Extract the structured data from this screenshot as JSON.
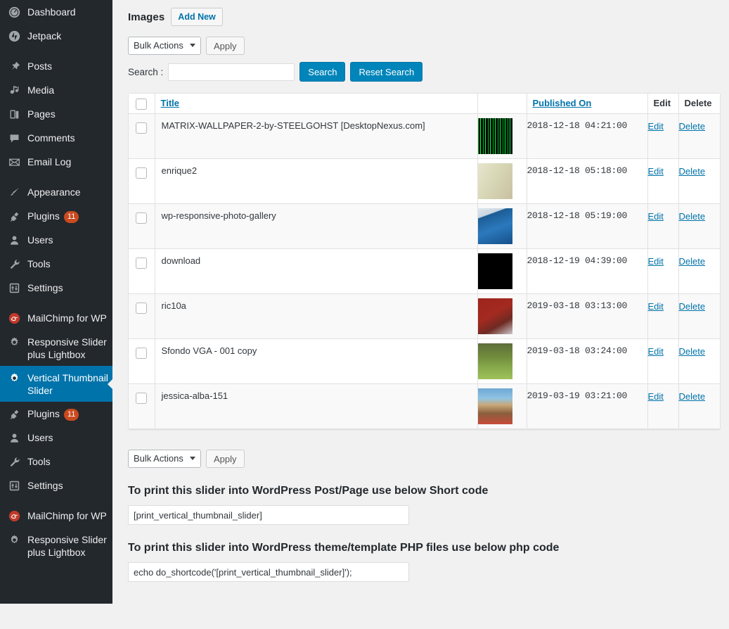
{
  "sidebar": {
    "groups": [
      {
        "items": [
          {
            "label": "Dashboard",
            "icon": "dashboard-icon"
          },
          {
            "label": "Jetpack",
            "icon": "jetpack-icon"
          }
        ]
      },
      {
        "items": [
          {
            "label": "Posts",
            "icon": "pin-icon"
          },
          {
            "label": "Media",
            "icon": "media-icon"
          },
          {
            "label": "Pages",
            "icon": "pages-icon"
          },
          {
            "label": "Comments",
            "icon": "comment-icon"
          },
          {
            "label": "Email Log",
            "icon": "envelope-icon"
          }
        ]
      },
      {
        "items": [
          {
            "label": "Appearance",
            "icon": "brush-icon"
          },
          {
            "label": "Plugins",
            "icon": "plug-icon",
            "badge": "11"
          },
          {
            "label": "Users",
            "icon": "user-icon"
          },
          {
            "label": "Tools",
            "icon": "wrench-icon"
          },
          {
            "label": "Settings",
            "icon": "settings-icon"
          }
        ]
      },
      {
        "items": [
          {
            "label": "MailChimp for WP",
            "icon": "mailchimp-icon"
          },
          {
            "label": "Responsive Slider plus Lightbox",
            "icon": "gear-icon"
          },
          {
            "label": "Vertical Thumbnail Slider",
            "icon": "gear-icon",
            "active": true
          },
          {
            "label": "Plugins",
            "icon": "plug-icon",
            "badge": "11"
          },
          {
            "label": "Users",
            "icon": "user-icon"
          },
          {
            "label": "Tools",
            "icon": "wrench-icon"
          },
          {
            "label": "Settings",
            "icon": "settings-icon"
          }
        ]
      },
      {
        "items": [
          {
            "label": "MailChimp for WP",
            "icon": "mailchimp-icon"
          },
          {
            "label": "Responsive Slider plus Lightbox",
            "icon": "gear-icon"
          }
        ]
      }
    ]
  },
  "header": {
    "title": "Images",
    "add_new_label": "Add New"
  },
  "toolbar_top": {
    "bulk_actions_label": "Bulk Actions",
    "apply_label": "Apply"
  },
  "search": {
    "label": "Search :",
    "value": "",
    "placeholder": "",
    "search_button": "Search",
    "reset_button": "Reset Search"
  },
  "table": {
    "columns": {
      "title": "Title",
      "published_on": "Published On",
      "edit": "Edit",
      "delete": "Delete"
    },
    "row_actions": {
      "edit": "Edit",
      "delete": "Delete"
    },
    "rows": [
      {
        "title": "MATRIX-WALLPAPER-2-by-STEELGOHST [DesktopNexus.com]",
        "published_on": "2018-12-18 04:21:00",
        "thumb": "matrix"
      },
      {
        "title": "enrique2",
        "published_on": "2018-12-18 05:18:00",
        "thumb": "enrique"
      },
      {
        "title": "wp-responsive-photo-gallery",
        "published_on": "2018-12-18 05:19:00",
        "thumb": "wpbox"
      },
      {
        "title": "download",
        "published_on": "2018-12-19 04:39:00",
        "thumb": "black"
      },
      {
        "title": "ric10a",
        "published_on": "2019-03-18 03:13:00",
        "thumb": "redportrait"
      },
      {
        "title": "Sfondo VGA - 001 copy",
        "published_on": "2019-03-18 03:24:00",
        "thumb": "grass"
      },
      {
        "title": "jessica-alba-151",
        "published_on": "2019-03-19 03:21:00",
        "thumb": "beach"
      }
    ]
  },
  "toolbar_bottom": {
    "bulk_actions_label": "Bulk Actions",
    "apply_label": "Apply"
  },
  "shortcode_section": {
    "heading": "To print this slider into WordPress Post/Page use below Short code",
    "value": "[print_vertical_thumbnail_slider]"
  },
  "php_section": {
    "heading": "To print this slider into WordPress theme/template PHP files use below php code",
    "value": "echo do_shortcode('[print_vertical_thumbnail_slider]');"
  },
  "colors": {
    "accent": "#0073aa",
    "sidebar_bg": "#23282d",
    "page_bg": "#f1f1f1",
    "badge": "#ca4a1f",
    "link": "#0073aa"
  }
}
